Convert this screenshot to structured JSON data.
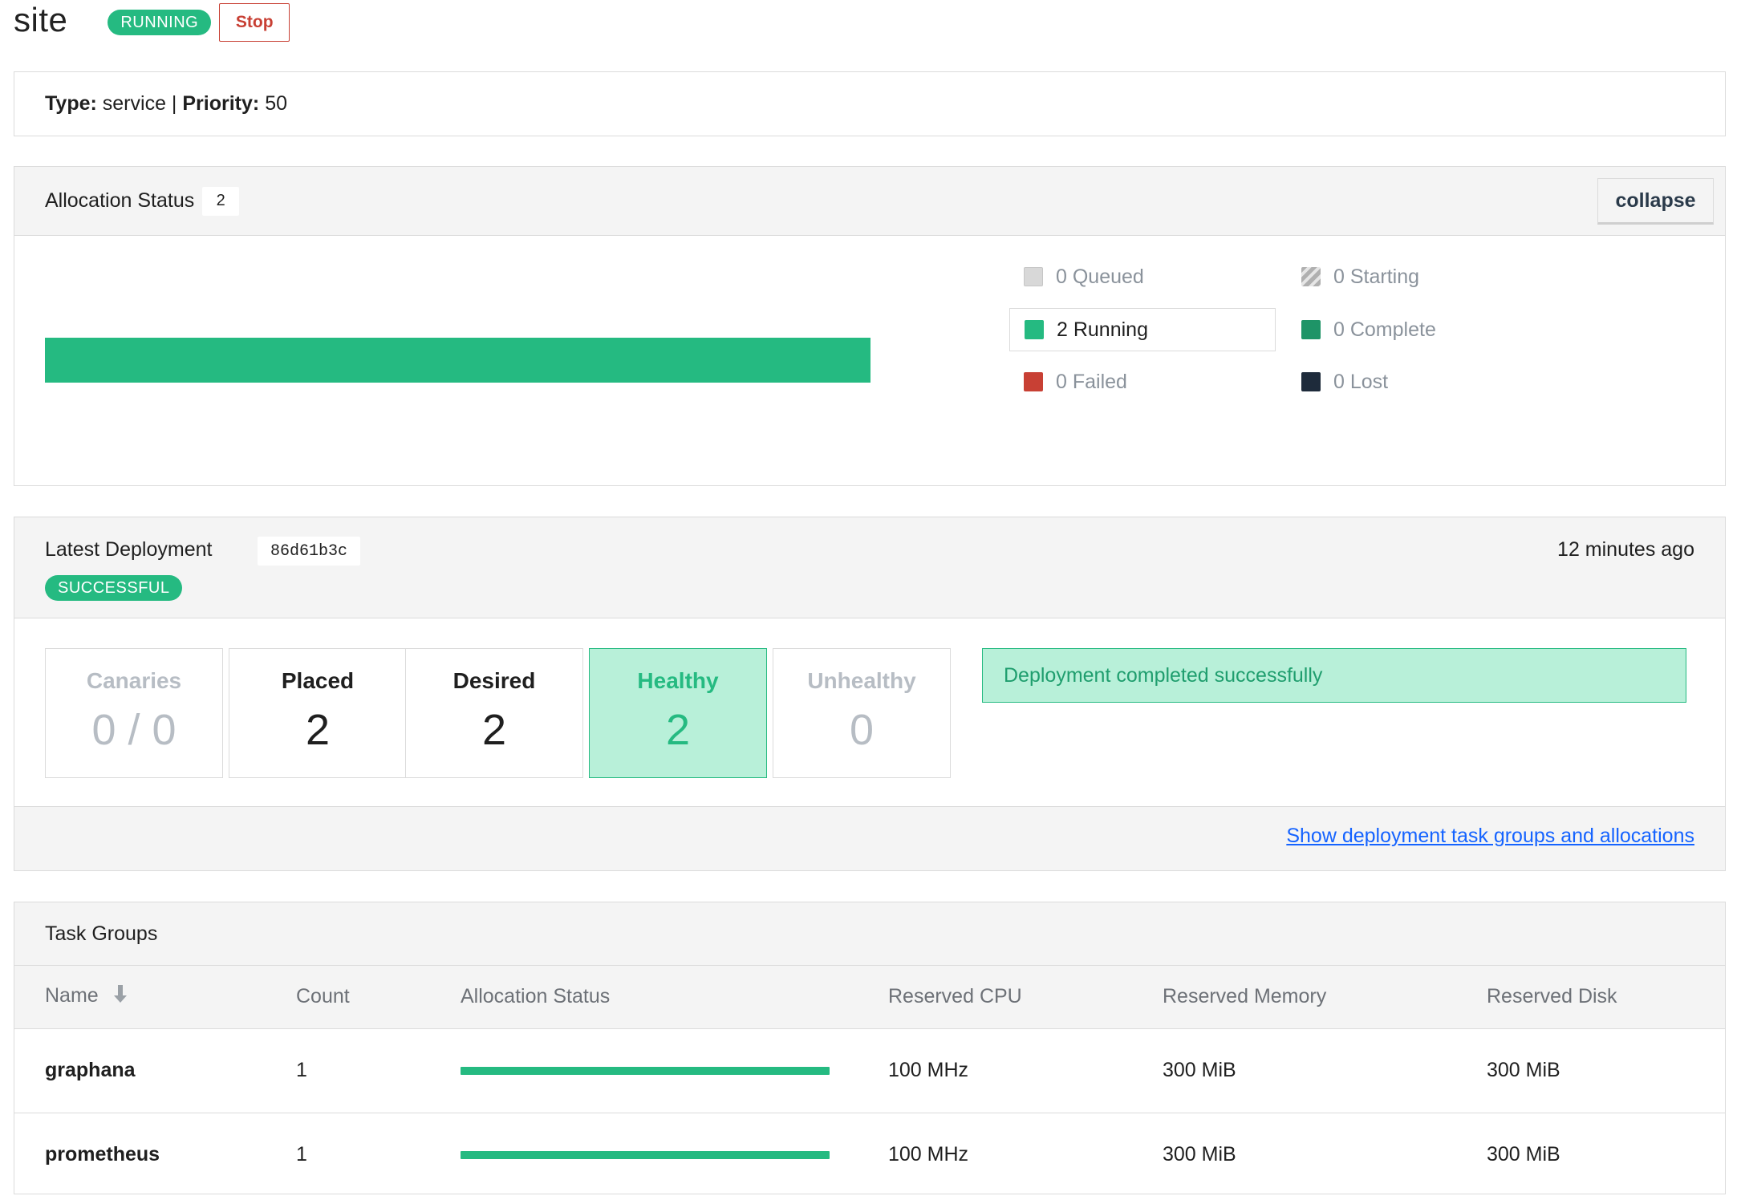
{
  "job": {
    "title": "site",
    "status_badge": "RUNNING",
    "stop_label": "Stop",
    "type_label": "Type:",
    "type_value": "service",
    "separator": "|",
    "priority_label": "Priority:",
    "priority_value": "50"
  },
  "allocation_status": {
    "title": "Allocation Status",
    "count": "2",
    "collapse_label": "collapse",
    "running_fraction": 1.0,
    "legend": [
      {
        "label": "0 Queued",
        "color": "#d8d8d8",
        "active": false
      },
      {
        "label": "0 Starting",
        "color": "#b0b0b0",
        "active": false
      },
      {
        "label": "2 Running",
        "color": "#25ba81",
        "active": true
      },
      {
        "label": "0 Complete",
        "color": "#1e9467",
        "active": false
      },
      {
        "label": "0 Failed",
        "color": "#c84034",
        "active": false
      },
      {
        "label": "0 Lost",
        "color": "#1e2b3b",
        "active": false
      }
    ]
  },
  "deployment": {
    "title": "Latest Deployment",
    "id": "86d61b3c",
    "time": "12 minutes ago",
    "status_badge": "SUCCESSFUL",
    "stats": {
      "canaries": {
        "label": "Canaries",
        "value": "0 / 0"
      },
      "placed": {
        "label": "Placed",
        "value": "2"
      },
      "desired": {
        "label": "Desired",
        "value": "2"
      },
      "healthy": {
        "label": "Healthy",
        "value": "2"
      },
      "unhealthy": {
        "label": "Unhealthy",
        "value": "0"
      }
    },
    "message": "Deployment completed successfully",
    "link": "Show deployment task groups and allocations"
  },
  "task_groups": {
    "title": "Task Groups",
    "columns": [
      "Name",
      "Count",
      "Allocation Status",
      "Reserved CPU",
      "Reserved Memory",
      "Reserved Disk"
    ],
    "rows": [
      {
        "name": "graphana",
        "count": "1",
        "alloc_fraction": 1.0,
        "cpu": "100 MHz",
        "memory": "300 MiB",
        "disk": "300 MiB"
      },
      {
        "name": "prometheus",
        "count": "1",
        "alloc_fraction": 1.0,
        "cpu": "100 MHz",
        "memory": "300 MiB",
        "disk": "300 MiB"
      }
    ]
  },
  "colors": {
    "accent_green": "#25ba81",
    "danger_red": "#c84034",
    "link_blue": "#1563ff"
  }
}
